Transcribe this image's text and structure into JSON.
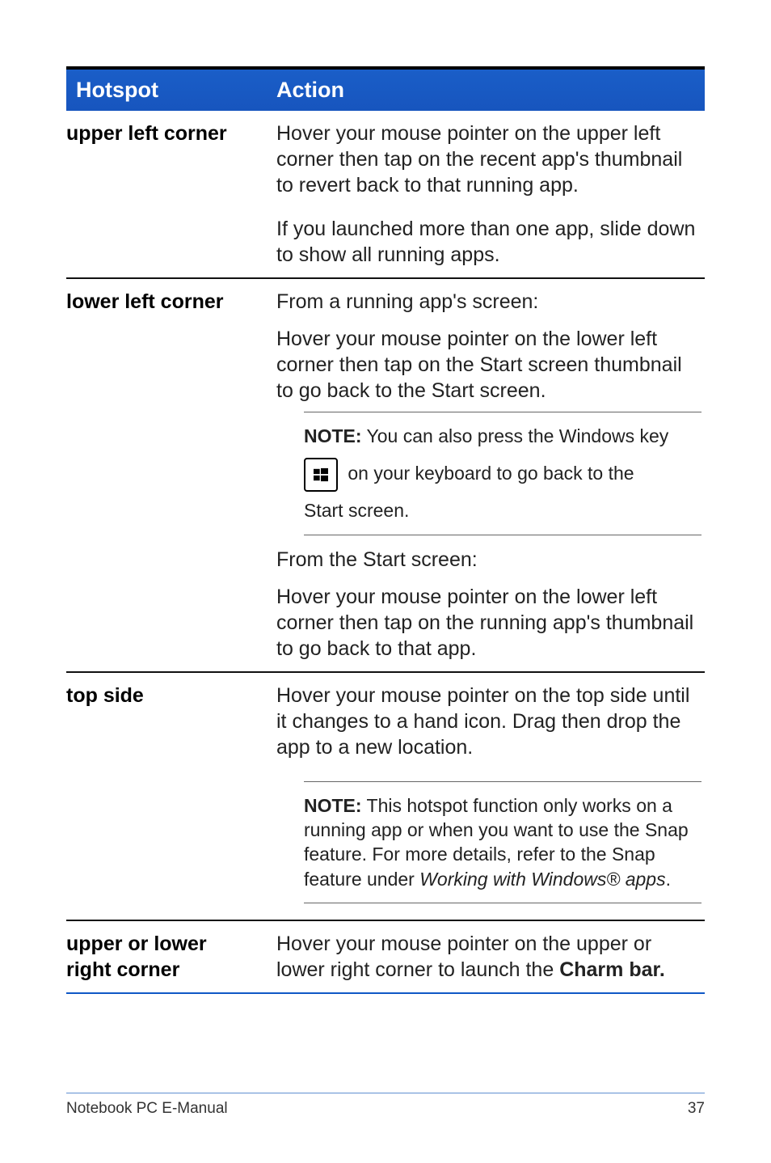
{
  "header": {
    "hotspot": "Hotspot",
    "action": "Action"
  },
  "rows": {
    "upper_left": {
      "label": "upper left corner",
      "para1": "Hover your mouse pointer on the upper left corner then tap on the recent app's thumbnail to revert back to that running app.",
      "para2": "If you launched more than one app, slide down to show all running apps."
    },
    "lower_left": {
      "label": "lower left corner",
      "para1": "From a running app's screen:",
      "para2": "Hover your mouse pointer on the lower left corner then tap on the Start screen thumbnail to go back to the Start screen.",
      "note_prefix": "NOTE:",
      "note_line1": " You can also press the Windows key",
      "note_line2_after": " on your keyboard to go back to the",
      "note_line3": "Start screen.",
      "para3": "From the Start screen:",
      "para4": "Hover your mouse pointer on the lower left corner then tap on the running app's thumbnail to go back to that app."
    },
    "top_side": {
      "label": "top side",
      "para1": "Hover your mouse pointer on the top side until it changes to a hand icon. Drag then drop the app to a new location.",
      "note_prefix": "NOTE:",
      "note_body1": " This hotspot function only works on a running app or when you want to use the Snap feature. For more details, refer to the Snap feature under ",
      "note_italic": "Working with Windows® apps",
      "note_body2": "."
    },
    "upper_lower_right": {
      "label_l1": "upper or lower",
      "label_l2": "right corner",
      "para_part1": "Hover your mouse pointer on the upper or lower right corner to launch the ",
      "para_bold": "Charm bar."
    }
  },
  "footer": {
    "left": "Notebook PC E-Manual",
    "right": "37"
  }
}
